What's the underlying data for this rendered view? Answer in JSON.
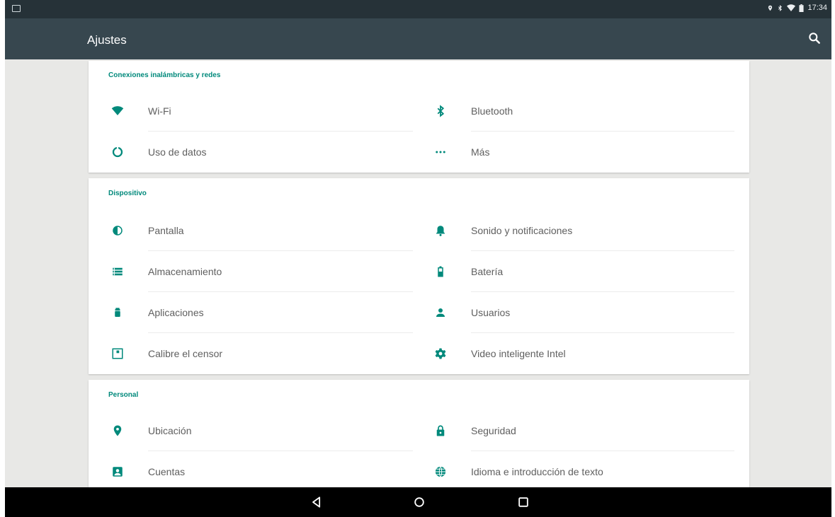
{
  "status_bar": {
    "time": "17:34",
    "icons": [
      "image-notification-icon",
      "location-icon",
      "bluetooth-icon",
      "wifi-icon",
      "battery-icon"
    ]
  },
  "toolbar": {
    "title": "Ajustes",
    "search_icon": "search-icon"
  },
  "sections": [
    {
      "header": "Conexiones inalámbricas y redes",
      "items": [
        {
          "label": "Wi-Fi",
          "icon": "wifi-icon"
        },
        {
          "label": "Bluetooth",
          "icon": "bluetooth-icon"
        },
        {
          "label": "Uso de datos",
          "icon": "data-usage-icon"
        },
        {
          "label": "Más",
          "icon": "more-icon"
        }
      ]
    },
    {
      "header": "Dispositivo",
      "items": [
        {
          "label": "Pantalla",
          "icon": "brightness-icon"
        },
        {
          "label": "Sonido y notificaciones",
          "icon": "bell-icon"
        },
        {
          "label": "Almacenamiento",
          "icon": "storage-icon"
        },
        {
          "label": "Batería",
          "icon": "battery-icon"
        },
        {
          "label": "Aplicaciones",
          "icon": "android-icon"
        },
        {
          "label": "Usuarios",
          "icon": "person-icon"
        },
        {
          "label": "Calibre el censor",
          "icon": "calibrate-icon"
        },
        {
          "label": "Video inteligente Intel",
          "icon": "gear-icon"
        }
      ]
    },
    {
      "header": "Personal",
      "items": [
        {
          "label": "Ubicación",
          "icon": "location-icon"
        },
        {
          "label": "Seguridad",
          "icon": "lock-icon"
        },
        {
          "label": "Cuentas",
          "icon": "account-icon"
        },
        {
          "label": "Idioma e introducción de texto",
          "icon": "globe-icon"
        }
      ]
    }
  ],
  "nav_bar": {
    "buttons": [
      "back-icon",
      "home-icon",
      "recents-icon"
    ]
  },
  "colors": {
    "accent": "#00897b",
    "toolbar": "#37474f",
    "status_bar": "#263238",
    "background": "#e8e8e6"
  }
}
